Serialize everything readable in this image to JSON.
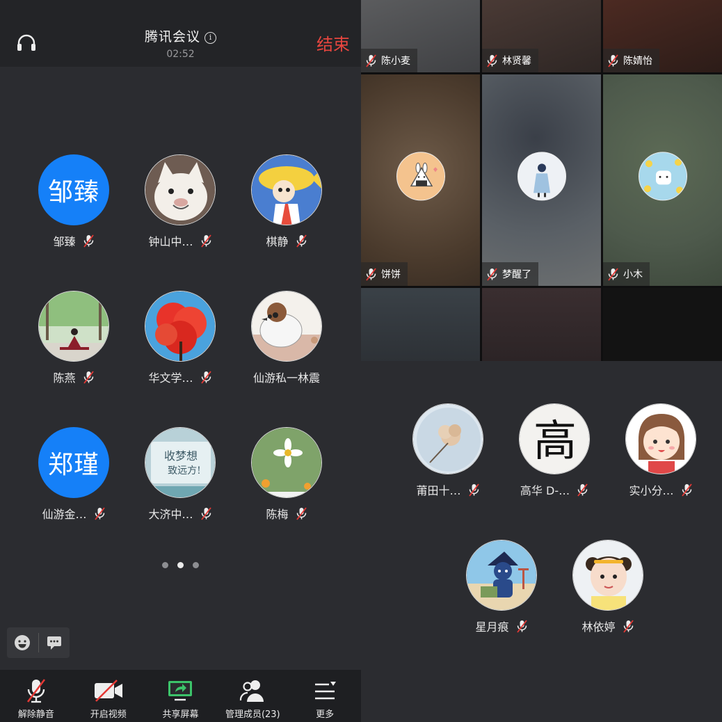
{
  "header": {
    "title": "腾讯会议",
    "info_glyph": "i",
    "timer": "02:52",
    "end_label": "结束"
  },
  "left_members": [
    {
      "name": "邹臻",
      "avatar_text": "邹臻",
      "avatar_type": "text",
      "muted": true
    },
    {
      "name": "钟山中…",
      "avatar_type": "photo-cat",
      "muted": true
    },
    {
      "name": "棋静",
      "avatar_type": "photo-cartoon-fish",
      "muted": true
    },
    {
      "name": "陈燕",
      "avatar_type": "photo-yoga-forest",
      "muted": true
    },
    {
      "name": "华文学…",
      "avatar_type": "photo-red-tree",
      "muted": true
    },
    {
      "name": "仙游私一林震",
      "avatar_type": "photo-sparrow",
      "muted": false
    },
    {
      "name": "仙游金…",
      "avatar_text": "郑瑾",
      "avatar_type": "text",
      "muted": true
    },
    {
      "name": "大济中…",
      "avatar_type": "photo-calligraphy-card",
      "muted": true
    },
    {
      "name": "陈梅",
      "avatar_type": "photo-white-flower",
      "muted": true
    }
  ],
  "pager": {
    "count": 3,
    "active": 1
  },
  "toolbar": {
    "unmute": "解除静音",
    "start_video": "开启视频",
    "share_screen": "共享屏幕",
    "manage_members": "管理成员(23)",
    "more": "更多"
  },
  "video_tiles": [
    {
      "name": "陈小麦",
      "muted": true
    },
    {
      "name": "林贤馨",
      "muted": true
    },
    {
      "name": "陈婧怡",
      "muted": true
    },
    {
      "name": "饼饼",
      "muted": true,
      "avatar": "rabbit-onigiri"
    },
    {
      "name": "梦醒了",
      "muted": true,
      "avatar": "girl-blue-dress"
    },
    {
      "name": "小木",
      "muted": true,
      "avatar": "cat-flowers"
    },
    {
      "name": "",
      "muted": false
    },
    {
      "name": "",
      "muted": false
    },
    {
      "name": "",
      "muted": false
    }
  ],
  "right_members": [
    {
      "name": "莆田十…",
      "avatar_type": "photo-dry-flower",
      "muted": true
    },
    {
      "name": "高华 D-…",
      "avatar_type": "calligraphy-gao",
      "avatar_text": "高",
      "muted": true
    },
    {
      "name": "实小分…",
      "avatar_type": "cartoon-girl",
      "muted": true
    },
    {
      "name": "星月痕",
      "avatar_type": "photo-blue-figure-beach",
      "muted": true
    },
    {
      "name": "林依婷",
      "avatar_type": "photo-little-girl",
      "muted": true
    }
  ],
  "colors": {
    "accent_blue": "#1580f8",
    "end_red": "#e8463f",
    "share_green": "#3cc36a",
    "mute_red": "#e53935"
  }
}
